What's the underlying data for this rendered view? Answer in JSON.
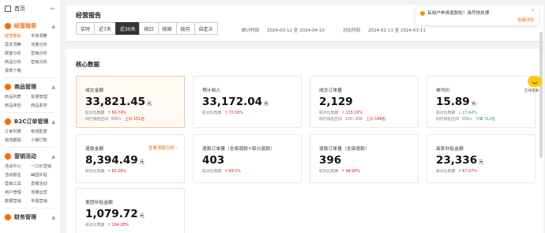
{
  "sidebar": {
    "home": "首页",
    "sections": [
      {
        "title": "经营指导",
        "items": [
          "经营看板",
          "市场洞察",
          "需求洞察",
          "流量分析",
          "顾客分析",
          "营销分析",
          "商品分析",
          "营销分析",
          "报表下载"
        ]
      },
      {
        "title": "商品管理",
        "items": [
          "商品列表",
          "批量管理",
          "商品体检",
          "商品素材"
        ]
      },
      {
        "title": "B2C订单管理",
        "items": [
          "订单列表",
          "物流配置",
          "物流跟踪",
          "小额打款"
        ]
      },
      {
        "title": "营销活动",
        "items": [
          "活动中心",
          "一口价营销",
          "活动报名",
          "幽团补贴",
          "营销工具",
          "直播活动",
          "用户管理",
          "流量运营",
          "数据营销",
          "专属营销"
        ]
      },
      {
        "title": "财务管理",
        "items": []
      }
    ]
  },
  "header": {
    "title": "经营报告",
    "tabs": [
      "实时",
      "近7天",
      "近30天",
      "按日",
      "按周",
      "按月",
      "自定义"
    ],
    "active_tab": "近30天",
    "stat_label": "统计时间",
    "stat_range": "2024-03-12 至 2024-04-10",
    "compare_label": "对比时间",
    "compare_range": "2024-02-11 至 2024-03-11"
  },
  "core": {
    "title": "核心数据",
    "cards": [
      {
        "title": "成交金额",
        "value": "33,821.45",
        "unit": "元",
        "cmp_label": "较对比周期",
        "cmp": "↑ 60.74%",
        "rank_label": "同行排名区间",
        "rank": "500+",
        "rank_delta": "上升 151名",
        "link": ""
      },
      {
        "title": "预计收入",
        "value": "33,172.04",
        "unit": "元",
        "cmp_label": "较对比周期",
        "cmp": "↑ 70.56%",
        "rank_label": "",
        "rank": "",
        "rank_delta": "",
        "link": ""
      },
      {
        "title": "成交订单量",
        "value": "2,129",
        "unit": "",
        "cmp_label": "较对比周期",
        "cmp": "↑ 133.19%",
        "rank_label": "同行排名区间",
        "rank": "150~200",
        "rank_delta": "上升 188名",
        "link": ""
      },
      {
        "title": "单均价",
        "value": "15.89",
        "unit": "元",
        "cmp_label": "较对比周期",
        "cmp": "↓ 27.64%",
        "rank_label": "同行排名区间",
        "rank": "500+",
        "rank_delta": "下降 312名",
        "link": ""
      },
      {
        "title": "退款金额",
        "value": "8,394.49",
        "unit": "元",
        "cmp_label": "较对比周期",
        "cmp": "↑ 82.28%",
        "rank_label": "",
        "rank": "",
        "rank_delta": "",
        "link": "查看退款分析 ›"
      },
      {
        "title": "退款订单量（全部退款+部分退款）",
        "value": "403",
        "unit": "",
        "cmp_label": "较对比周期",
        "cmp": "↑ 89.5%",
        "rank_label": "",
        "rank": "",
        "rank_delta": "",
        "link": ""
      },
      {
        "title": "退款订单量（全部退款）",
        "value": "396",
        "unit": "",
        "cmp_label": "较对比周期",
        "cmp": "↑ 98.99%",
        "rank_label": "",
        "rank": "",
        "rank_delta": "",
        "link": ""
      },
      {
        "title": "商家补贴金额",
        "value": "23,336",
        "unit": "元",
        "cmp_label": "较对比周期",
        "cmp": "↑ 67.97%",
        "rank_label": "",
        "rank": "",
        "rank_delta": "",
        "link": ""
      },
      {
        "title": "美团补贴金额",
        "value": "1,079.72",
        "unit": "元",
        "cmp_label": "较对比周期",
        "cmp": "↑ 164.28%",
        "rank_label": "",
        "rank": "",
        "rank_delta": "",
        "link": ""
      }
    ]
  },
  "notice": {
    "text": "有用户申请退款啦！请尽快处理",
    "link": "查看详情",
    "close": "×"
  },
  "helper": {
    "label": "在线客服"
  },
  "colors": {
    "accent": "#ff6a00",
    "up": "#e02020",
    "down": "#1aa34a"
  }
}
